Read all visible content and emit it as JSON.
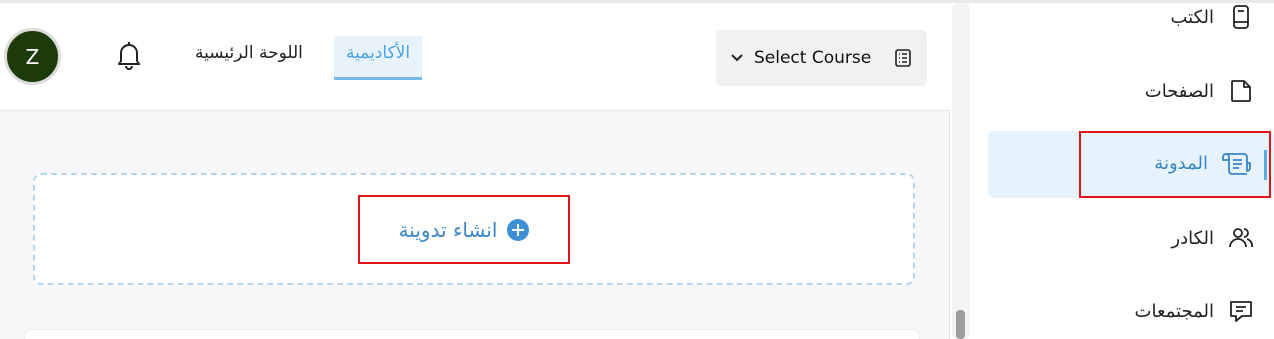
{
  "header": {
    "avatar_letter": "Z",
    "nav": {
      "home": "اللوحة الرئيسية",
      "academy": "الأكاديمية"
    },
    "course_select": {
      "label": "Select Course"
    }
  },
  "main": {
    "create_post_label": "انشاء تدوينة"
  },
  "sidebar": {
    "items": [
      {
        "label": "الكتب",
        "icon": "book-icon"
      },
      {
        "label": "الصفحات",
        "icon": "page-icon"
      },
      {
        "label": "المدونة",
        "icon": "blog-icon",
        "active": true
      },
      {
        "label": "الكادر",
        "icon": "users-icon"
      },
      {
        "label": "المجتمعات",
        "icon": "chat-icon"
      }
    ]
  },
  "colors": {
    "accent": "#4aa3e6",
    "highlight_border": "#e01515",
    "avatar_bg": "#1d3a0a"
  }
}
